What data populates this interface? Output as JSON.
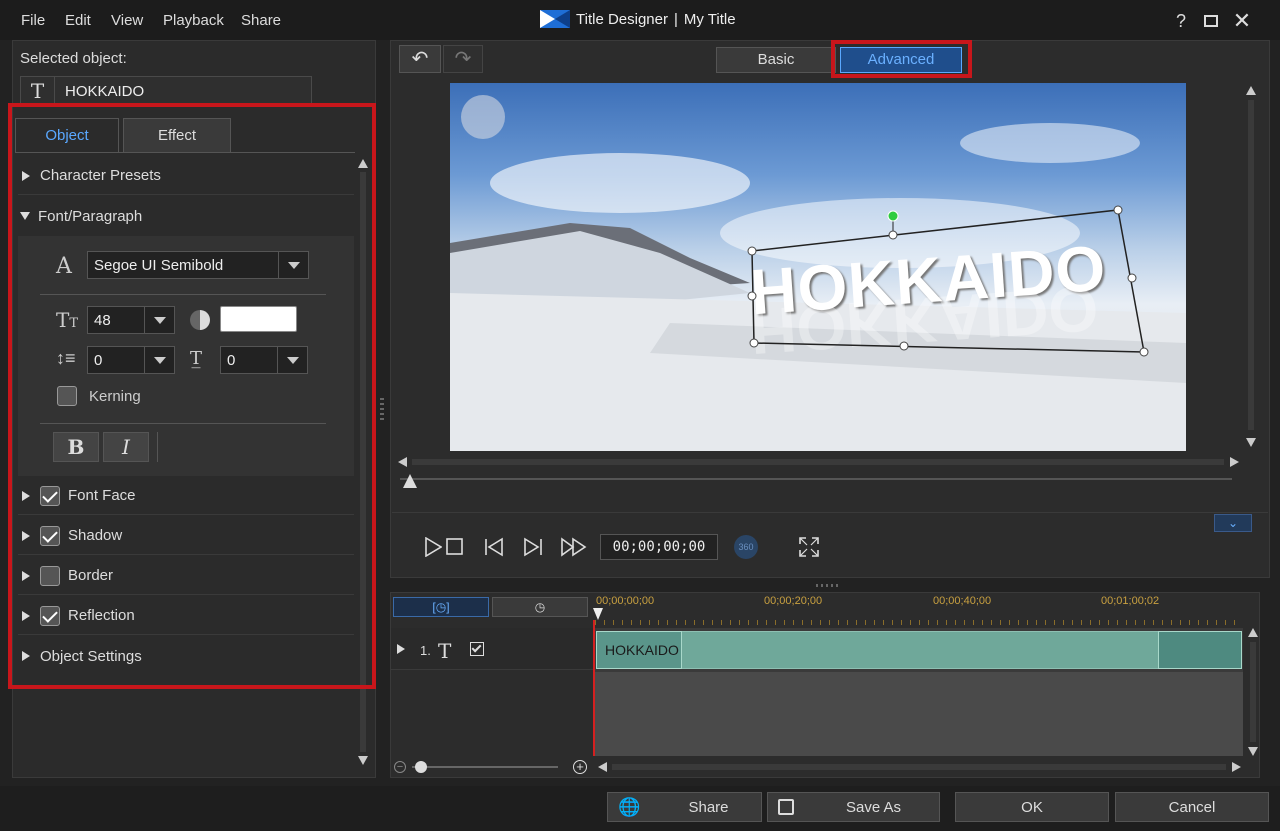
{
  "menu": {
    "file": "File",
    "edit": "Edit",
    "view": "View",
    "playback": "Playback",
    "share": "Share"
  },
  "window": {
    "app": "Title Designer",
    "separator": "|",
    "doc": "My Title"
  },
  "selected": {
    "label": "Selected object:",
    "value": "HOKKAIDO"
  },
  "tabs": {
    "object": "Object",
    "effect": "Effect"
  },
  "sections": {
    "presets": "Character Presets",
    "fontpara": "Font/Paragraph",
    "fontface": "Font Face",
    "shadow": "Shadow",
    "border": "Border",
    "reflection": "Reflection",
    "objsettings": "Object Settings"
  },
  "font": {
    "family": "Segoe UI Semibold",
    "size": "48",
    "line_spacing": "0",
    "char_spacing": "0",
    "kerning": "Kerning",
    "bold": "B",
    "italic": "I",
    "color": "#ffffff"
  },
  "mode": {
    "basic": "Basic",
    "advanced": "Advanced"
  },
  "preview": {
    "title_text": "HOKKAIDO",
    "timecode": "00;00;00;00",
    "badge": "360"
  },
  "timeline": {
    "ruler": [
      "00;00;00;00",
      "00;00;20;00",
      "00;00;40;00",
      "00;01;00;02"
    ],
    "track_num": "1.",
    "clip": "HOKKAIDO"
  },
  "buttons": {
    "share": "Share",
    "saveas": "Save As",
    "ok": "OK",
    "cancel": "Cancel"
  },
  "colors": {
    "accent": "#5aa8ff",
    "highlight": "#c8161b",
    "clip": "#6fa89a"
  }
}
